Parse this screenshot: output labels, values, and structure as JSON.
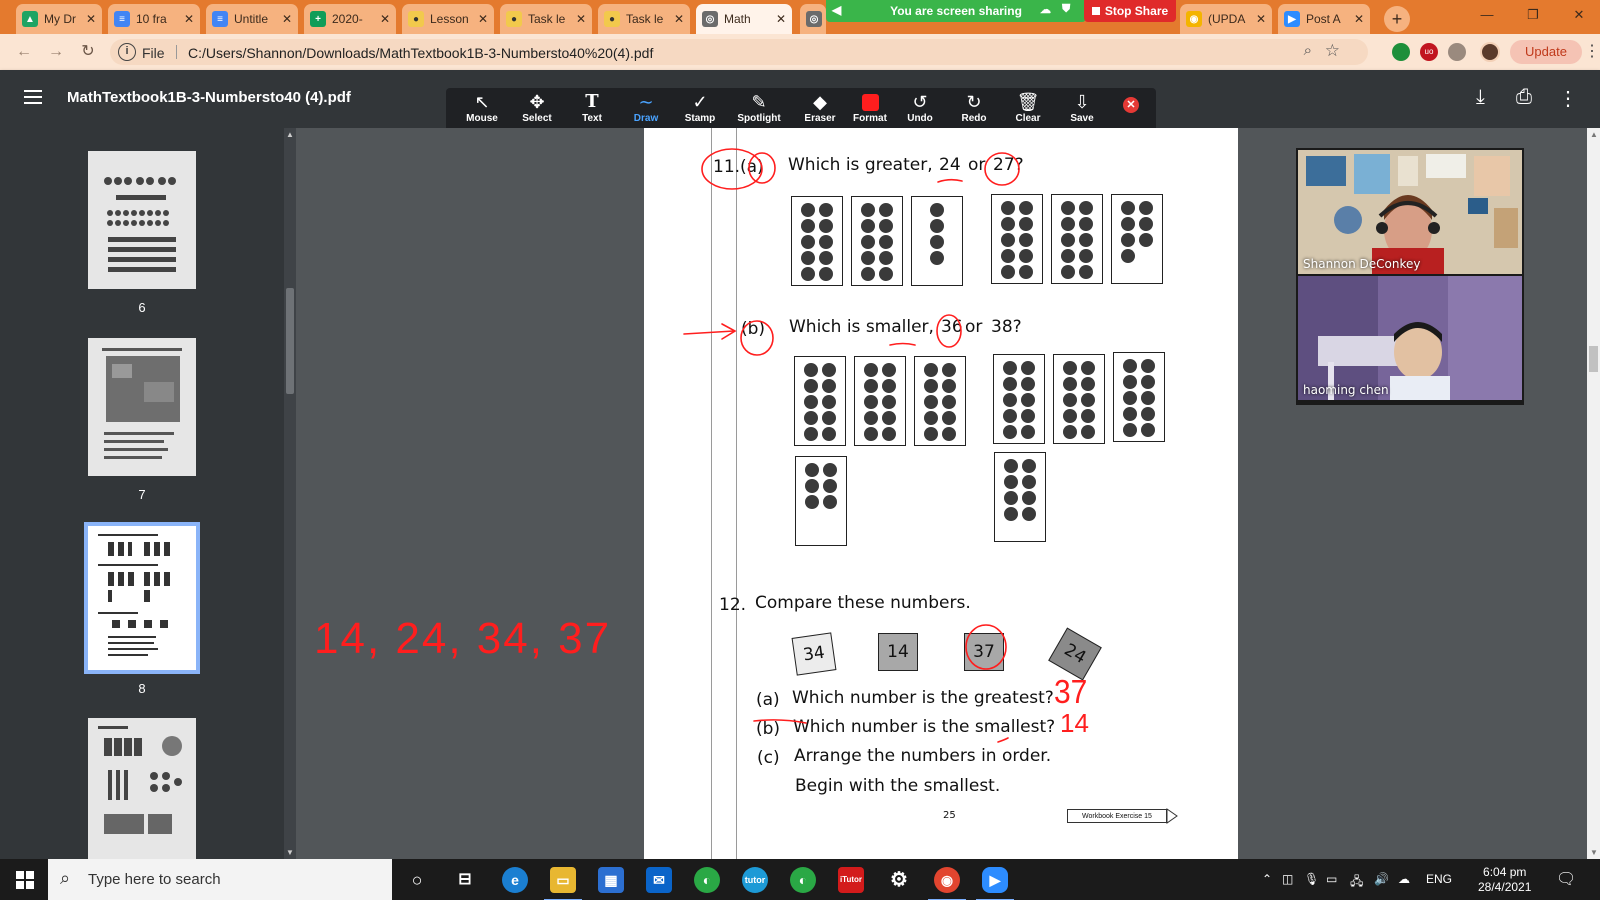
{
  "browser": {
    "tabs": [
      {
        "label": "My Dr",
        "icon": "google-drive-icon",
        "color": "#1fa463"
      },
      {
        "label": "10 fra",
        "icon": "google-docs-icon",
        "color": "#4285f4"
      },
      {
        "label": "Untitle",
        "icon": "google-docs-icon",
        "color": "#4285f4"
      },
      {
        "label": "2020-",
        "icon": "google-sheets-icon",
        "color": "#0f9d58"
      },
      {
        "label": "Lesson",
        "icon": "classroom-icon",
        "color": "#f2c94c"
      },
      {
        "label": "Task le",
        "icon": "classroom-icon",
        "color": "#f2c94c"
      },
      {
        "label": "Task le",
        "icon": "classroom-icon",
        "color": "#f2c94c"
      },
      {
        "label": "Math",
        "icon": "globe-icon",
        "color": "#6b6b6b"
      },
      {
        "label": "(UPDA",
        "icon": "site-icon",
        "color": "#f4b400"
      },
      {
        "label": "Post A",
        "icon": "zoom-icon",
        "color": "#2d8cff"
      }
    ],
    "screen_share": {
      "status": "You are screen sharing",
      "stop_label": "Stop Share"
    },
    "address": {
      "scheme_label": "File",
      "url": "C:/Users/Shannon/Downloads/MathTextbook1B-3-Numbersto40%20(4).pdf"
    },
    "update_label": "Update"
  },
  "pdf": {
    "title": "MathTextbook1B-3-Numbersto40 (4).pdf",
    "tools": [
      {
        "label": "Mouse",
        "glyph": "↖"
      },
      {
        "label": "Select",
        "glyph": "✥"
      },
      {
        "label": "Text",
        "glyph": "T"
      },
      {
        "label": "Draw",
        "glyph": "∼"
      },
      {
        "label": "Stamp",
        "glyph": "✓"
      },
      {
        "label": "Spotlight",
        "glyph": "✎"
      },
      {
        "label": "Eraser",
        "glyph": "◆"
      },
      {
        "label": "Format",
        "glyph": ""
      },
      {
        "label": "Undo",
        "glyph": "↺"
      },
      {
        "label": "Redo",
        "glyph": "↻"
      },
      {
        "label": "Clear",
        "glyph": "🗑"
      },
      {
        "label": "Save",
        "glyph": "⇩"
      }
    ],
    "active_tool": "Draw",
    "draw_color": "#ff1e1e",
    "thumbnails": [
      {
        "page": "6"
      },
      {
        "page": "7"
      },
      {
        "page": "8",
        "selected": true
      },
      {
        "page": ""
      }
    ],
    "page_content": {
      "q11_number": "11.",
      "q11a_label": "(a)",
      "q11a_text_pre": "Which is greater,",
      "q11a_n1": "24",
      "q11a_or": "or",
      "q11a_n2": "27?",
      "q11b_label": "(b)",
      "q11b_text_pre": "Which is smaller,",
      "q11b_n1": "36",
      "q11b_or": "or",
      "q11b_n2": "38?",
      "q12_number": "12.",
      "q12_title": "Compare these numbers.",
      "cards": [
        "34",
        "14",
        "37",
        "24"
      ],
      "q12a_label": "(a)",
      "q12a_text": "Which number is the greatest?",
      "q12b_label": "(b)",
      "q12b_text": "Which number is the smallest?",
      "q12c_label": "(c)",
      "q12c_text": "Arrange the numbers in order.",
      "q12c_text2": "Begin with the smallest.",
      "page_number": "25",
      "footer_tag": "Workbook Exercise 15"
    },
    "annotations": {
      "answer_greatest": "37",
      "answer_smallest": "14",
      "order_text": "14, 24, 34, 37"
    }
  },
  "video": {
    "participants": [
      {
        "name": "Shannon DeConkey"
      },
      {
        "name": "haoming chen"
      }
    ]
  },
  "taskbar": {
    "search_placeholder": "Type here to search",
    "language": "ENG",
    "time": "6:04 pm",
    "date": "28/4/2021"
  }
}
